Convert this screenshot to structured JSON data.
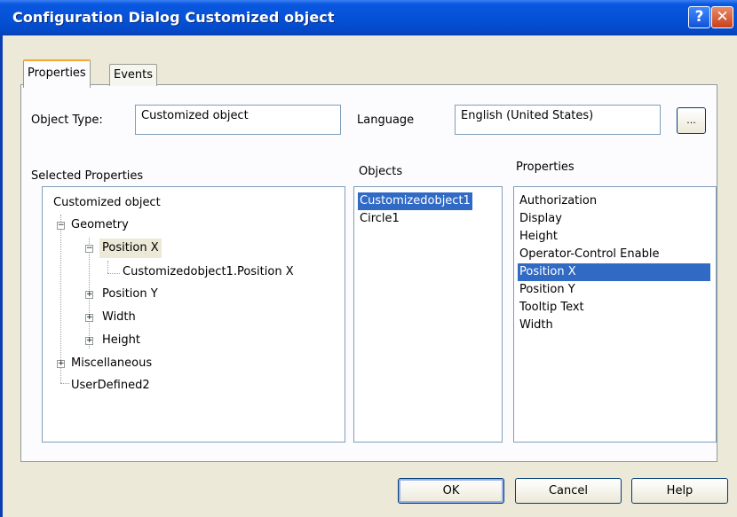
{
  "window": {
    "title": "Configuration Dialog Customized object",
    "help_symbol": "?",
    "close_symbol": "✕"
  },
  "tabs": [
    {
      "label": "Properties",
      "active": true
    },
    {
      "label": "Events",
      "active": false
    }
  ],
  "object_type": {
    "label": "Object Type:",
    "value": "Customized object"
  },
  "language": {
    "label": "Language",
    "value": "English (United States)",
    "browse_label": "..."
  },
  "selected_properties": {
    "header": "Selected Properties",
    "tree": [
      {
        "label": "Customized object"
      },
      {
        "label": "Geometry"
      },
      {
        "label": "Position X"
      },
      {
        "label": "Customizedobject1.Position X"
      },
      {
        "label": "Position Y"
      },
      {
        "label": "Width"
      },
      {
        "label": "Height"
      },
      {
        "label": "Miscellaneous"
      },
      {
        "label": "UserDefined2"
      }
    ],
    "expander_symbols": {
      "expanded": "−",
      "collapsed": "+"
    }
  },
  "objects": {
    "header": "Objects",
    "items": [
      "Customizedobject1",
      "Circle1"
    ]
  },
  "properties": {
    "header": "Properties",
    "items": [
      "Authorization",
      "Display",
      "Height",
      "Operator-Control Enable",
      "Position X",
      "Position Y",
      "Tooltip Text",
      "Width"
    ]
  },
  "buttons": {
    "ok": "OK",
    "cancel": "Cancel",
    "help": "Help"
  },
  "colors": {
    "titlebar": "#0552d8",
    "selection": "#316ac5",
    "tab_highlight": "#f5a832",
    "dialog_bg": "#ece9d8"
  }
}
